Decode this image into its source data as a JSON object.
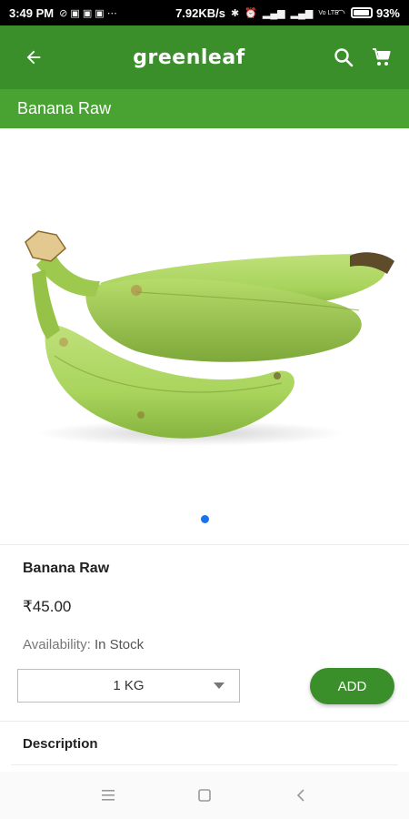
{
  "status_bar": {
    "time": "3:49 PM",
    "network_speed": "7.92KB/s",
    "volte": "Vo LTE",
    "battery_percent": "93%",
    "battery_level": 0.93
  },
  "app_bar": {
    "brand": "greenleaf",
    "back_icon": "arrow-left-icon",
    "search_icon": "search-icon",
    "cart_icon": "cart-icon",
    "color": "#3a8f2a"
  },
  "page_title": "Banana Raw",
  "product": {
    "image": "banana-raw-image",
    "carousel_active_index": 1,
    "carousel_total": 1,
    "name": "Banana Raw",
    "price": "₹45.00",
    "availability_label": "Availability:",
    "availability_value": "In Stock",
    "quantity_selected": "1 KG",
    "add_button": "ADD"
  },
  "description": {
    "title": "Description"
  },
  "nav_bar": {
    "menu_icon": "menu-icon",
    "home_icon": "home-square-icon",
    "back_icon": "back-chevron-icon"
  }
}
